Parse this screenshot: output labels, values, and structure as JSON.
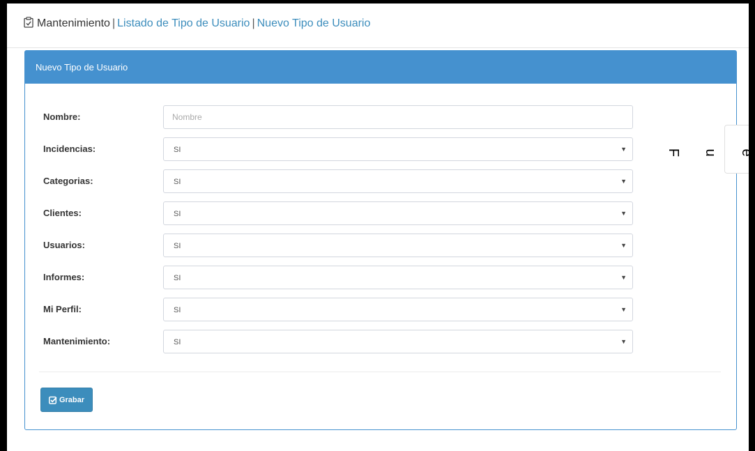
{
  "breadcrumb": {
    "root": "Mantenimiento",
    "link_list": "Listado de Tipo de Usuario",
    "link_new": "Nuevo Tipo de Usuario",
    "icon": "clipboard-check-icon"
  },
  "panel": {
    "title": "Nuevo Tipo de Usuario"
  },
  "form": {
    "nombre": {
      "label": "Nombre:",
      "placeholder": "Nombre",
      "value": ""
    },
    "incidencias": {
      "label": "Incidencias:",
      "value": "SI"
    },
    "categorias": {
      "label": "Categorias:",
      "value": "SI"
    },
    "clientes": {
      "label": "Clientes:",
      "value": "SI"
    },
    "usuarios": {
      "label": "Usuarios:",
      "value": "SI"
    },
    "informes": {
      "label": "Informes:",
      "value": "SI"
    },
    "mi_perfil": {
      "label": "Mi Perfil:",
      "value": "SI"
    },
    "mantenimiento": {
      "label": "Mantenimiento:",
      "value": "SI"
    },
    "select_arrow": "▼"
  },
  "actions": {
    "save_label": "Grabar",
    "save_icon": "check-square-icon"
  },
  "side_tab": {
    "letters": [
      "F",
      "u",
      "e"
    ]
  },
  "colors": {
    "primary": "#4591cf",
    "link": "#3c8dbc",
    "button": "#3c8dbc"
  }
}
